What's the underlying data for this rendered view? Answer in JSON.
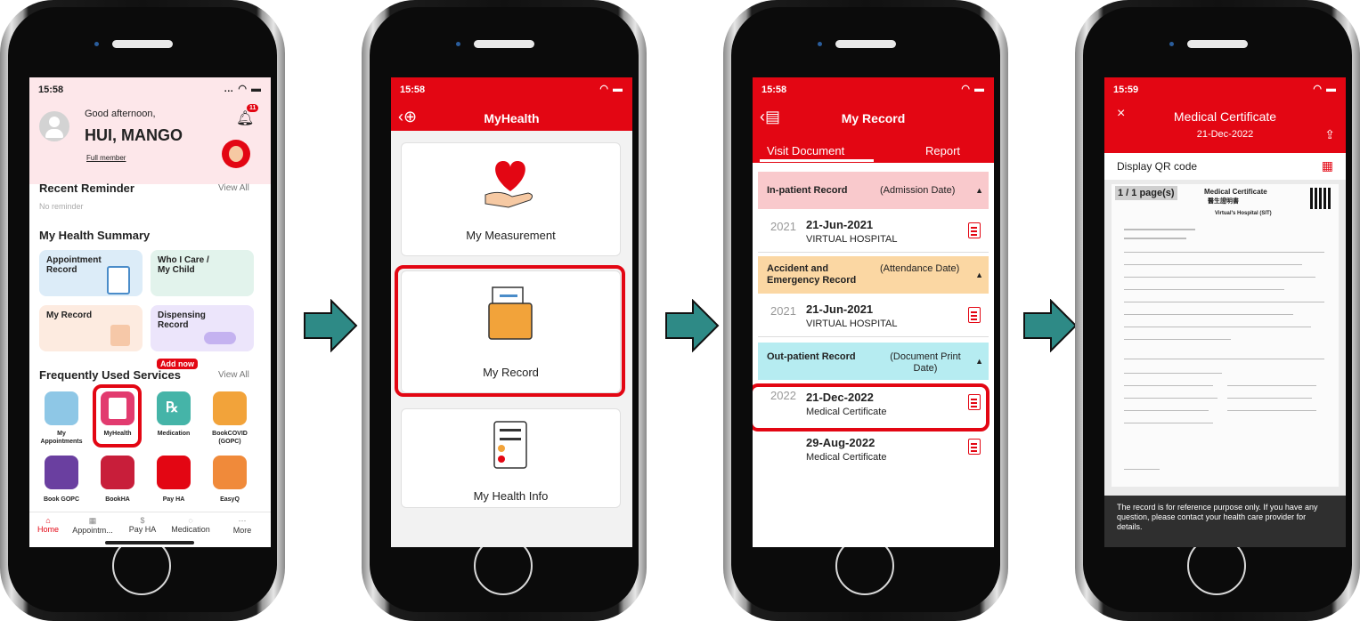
{
  "colors": {
    "accent": "#e30613",
    "arrow": "#2e8a86"
  },
  "screen1": {
    "status_time": "15:58",
    "greeting": "Good afternoon,",
    "user_name": "HUI, MANGO",
    "member_link": "Full member",
    "bell_badge": "11",
    "recent_reminder_title": "Recent Reminder",
    "recent_reminder_view_all": "View All",
    "no_reminder": "No reminder",
    "summary_title": "My Health Summary",
    "cards": {
      "appointment": "Appointment Record",
      "who_i_care": "Who I Care / My Child",
      "add_now": "Add now",
      "my_record": "My Record",
      "dispensing": "Dispensing Record"
    },
    "services_title": "Frequently Used Services",
    "services_view_all": "View All",
    "services": [
      "My Appointments",
      "MyHealth",
      "Medication",
      "BookCOVID (GOPC)",
      "Book GOPC",
      "BookHA",
      "Pay HA",
      "EasyQ"
    ],
    "tabs": [
      "Home",
      "Appointm...",
      "Pay HA",
      "Medication",
      "More"
    ]
  },
  "screen2": {
    "status_time": "15:58",
    "title": "MyHealth",
    "items": [
      "My Measurement",
      "My Record",
      "My Health Info"
    ]
  },
  "screen3": {
    "status_time": "15:58",
    "title": "My Record",
    "tab_active": "Visit Document",
    "tab_other": "Report",
    "sections": [
      {
        "title": "In-patient Record",
        "sort": "(Admission Date)"
      },
      {
        "title": "Accident and Emergency Record",
        "sort": "(Attendance Date)"
      },
      {
        "title": "Out-patient Record",
        "sort": "(Document Print Date)"
      }
    ],
    "inpatient": {
      "year": "2021",
      "date": "21-Jun-2021",
      "name": "VIRTUAL HOSPITAL"
    },
    "ae": {
      "year": "2021",
      "date": "21-Jun-2021",
      "name": "VIRTUAL HOSPITAL"
    },
    "outpatient": [
      {
        "year": "2022",
        "date": "21-Dec-2022",
        "name": "Medical Certificate"
      },
      {
        "year": "",
        "date": "29-Aug-2022",
        "name": "Medical Certificate"
      }
    ]
  },
  "screen4": {
    "status_time": "15:59",
    "title": "Medical Certificate",
    "subtitle": "21-Dec-2022",
    "qr_label": "Display QR code",
    "page_label": "1 / 1 page(s)",
    "doc_title": "Medical Certificate",
    "doc_title_cn": "醫生證明書",
    "doc_hospital": "Virtual's Hospital (SIT)",
    "note": "The record is for reference purpose only. If you have any question, please contact your health care provider for details."
  }
}
